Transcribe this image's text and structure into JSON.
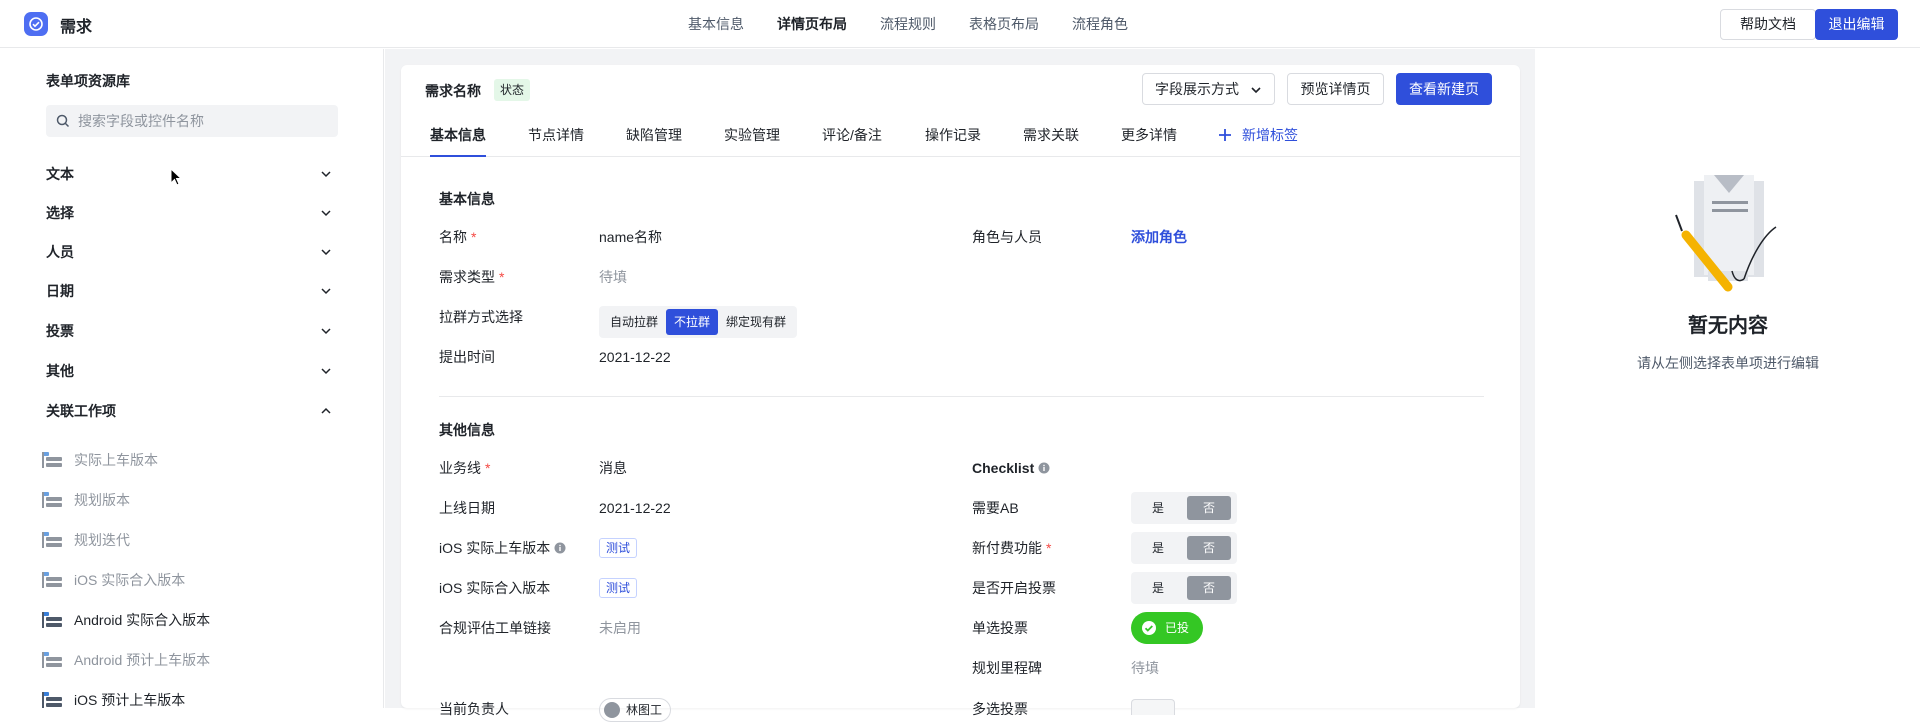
{
  "app": {
    "title": "需求"
  },
  "nav": {
    "items": [
      "基本信息",
      "详情页布局",
      "流程规则",
      "表格页布局",
      "流程角色"
    ],
    "active": "详情页布局"
  },
  "header": {
    "help": "帮助文档",
    "exit": "退出编辑"
  },
  "library": {
    "title": "表单项资源库",
    "search_placeholder": "搜索字段或控件名称",
    "categories": [
      "文本",
      "选择",
      "人员",
      "日期",
      "投票",
      "其他",
      "关联工作项"
    ],
    "items": [
      "实际上车版本",
      "规划版本",
      "规划迭代",
      "iOS 实际合入版本",
      "Android 实际合入版本",
      "Android 预计上车版本",
      "iOS 预计上车版本"
    ]
  },
  "card": {
    "title": "需求名称",
    "status": "状态",
    "field_mode": "字段展示方式",
    "preview": "预览详情页",
    "view_new": "查看新建页",
    "tabs": [
      "基本信息",
      "节点详情",
      "缺陷管理",
      "实验管理",
      "评论/备注",
      "操作记录",
      "需求关联",
      "更多详情"
    ],
    "add_tab": "新增标签"
  },
  "basic": {
    "title": "基本信息",
    "name_label": "名称",
    "name_value": "name名称",
    "type_label": "需求类型",
    "type_value": "待填",
    "group_label": "拉群方式选择",
    "group_options": [
      "自动拉群",
      "不拉群",
      "绑定现有群"
    ],
    "time_label": "提出时间",
    "time_value": "2021-12-22",
    "role_label": "角色与人员",
    "role_value": "添加角色",
    "required_mark": "*"
  },
  "other": {
    "title": "其他信息",
    "biz_label": "业务线",
    "biz_value": "消息",
    "online_label": "上线日期",
    "online_value": "2021-12-22",
    "ios_car_label": "iOS 实际上车版本",
    "ios_car_value": "测试",
    "ios_merge_label": "iOS 实际合入版本",
    "ios_merge_value": "测试",
    "compliance_label": "合规评估工单链接",
    "compliance_value": "未启用",
    "owner_label": "当前负责人",
    "owner_value": "林图工",
    "checklist_label": "Checklist",
    "ab_label": "需要AB",
    "pay_label": "新付费功能",
    "vote_open_label": "是否开启投票",
    "yes": "是",
    "no": "否",
    "single_vote_label": "单选投票",
    "single_vote_value": "已投",
    "milestone_label": "规划里程碑",
    "milestone_value": "待填",
    "more_label": "多选投票"
  },
  "empty": {
    "title": "暂无内容",
    "subtitle": "请从左侧选择表单项进行编辑"
  },
  "colors": {
    "accent": "#2f4fdb",
    "vote": "#34c724",
    "required": "#f54a45"
  }
}
